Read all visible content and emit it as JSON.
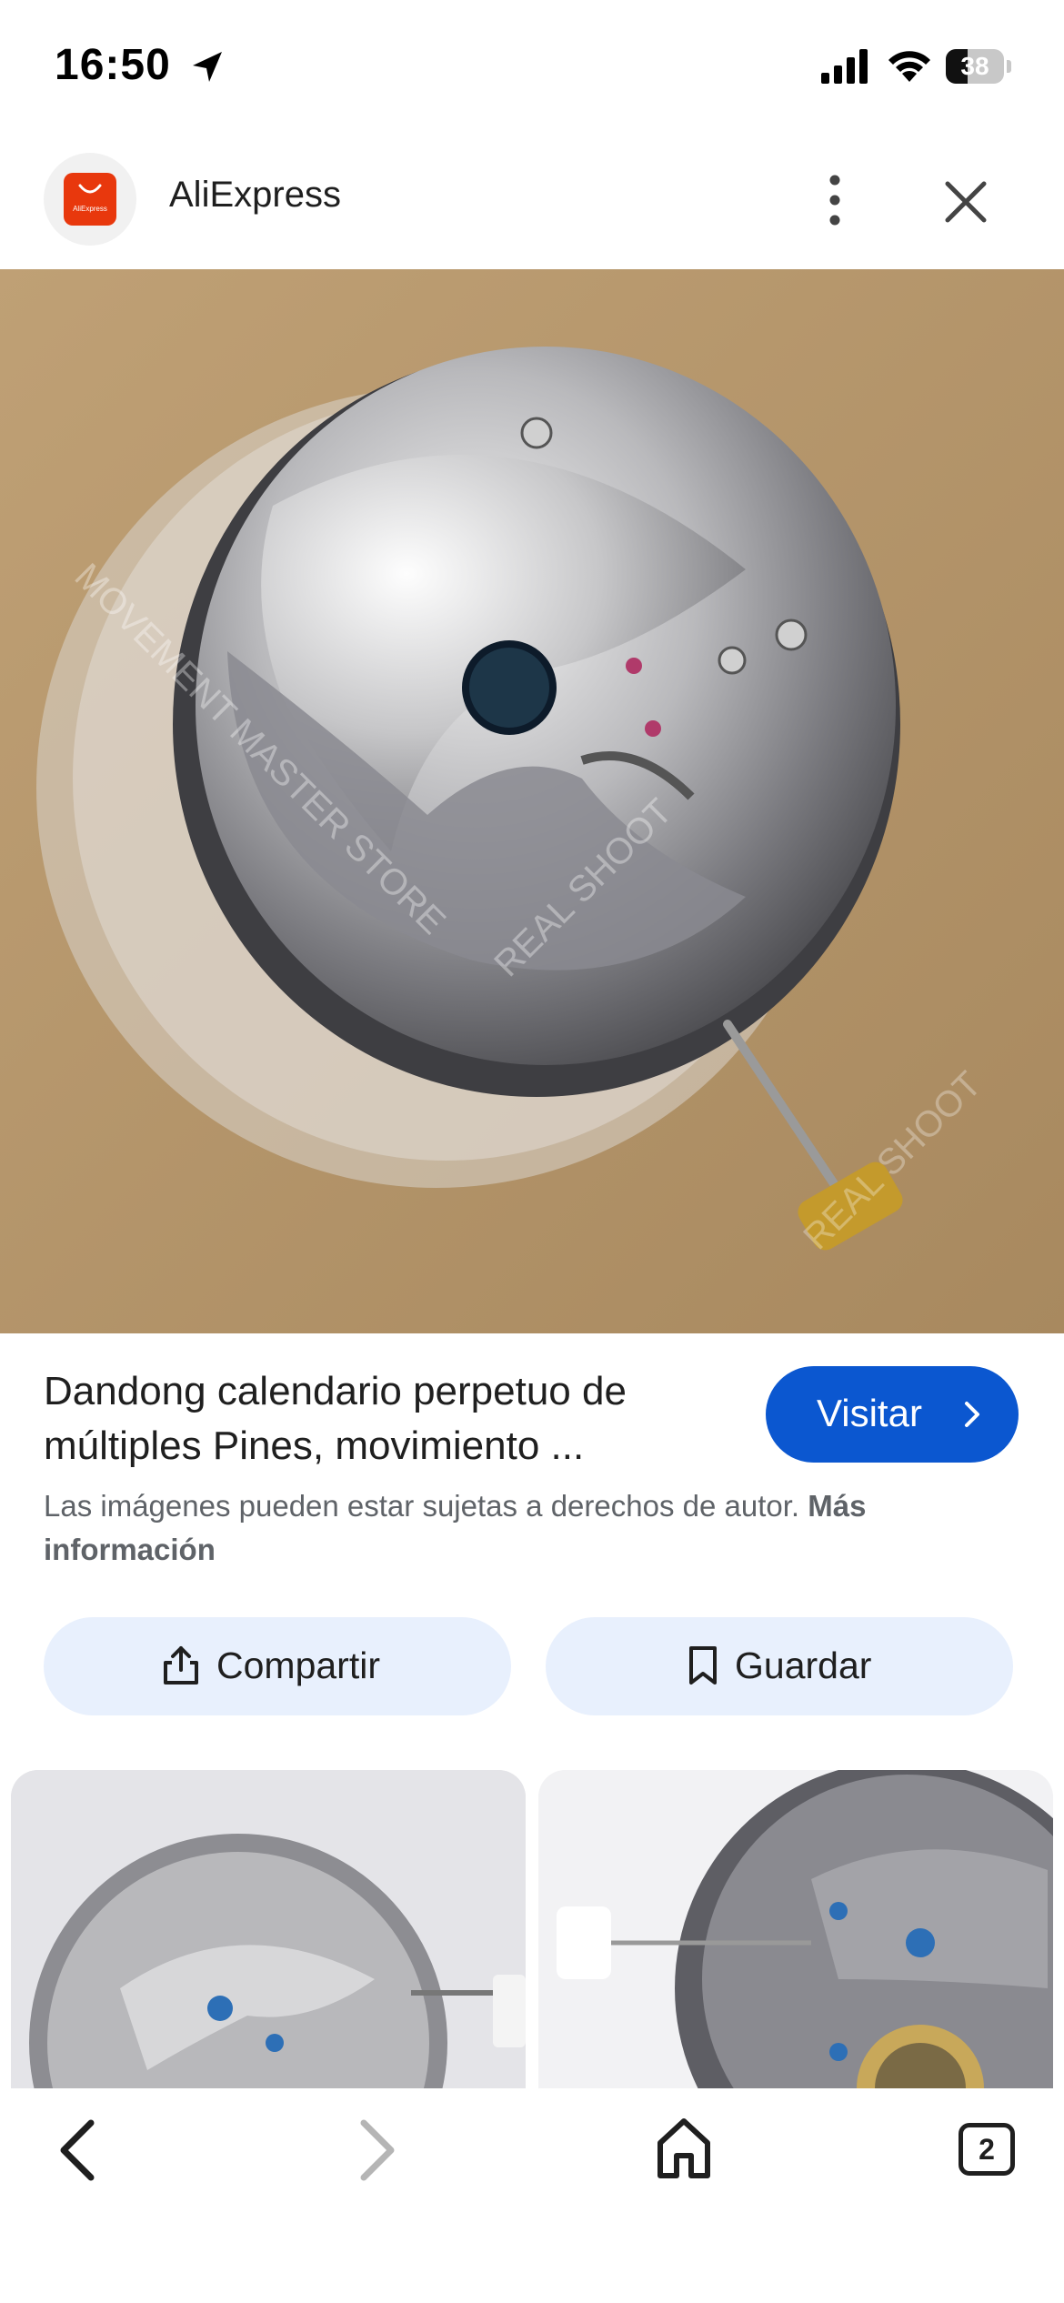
{
  "status_bar": {
    "time": "16:50",
    "battery_percent": "38",
    "battery_level": 0.38,
    "icons": [
      "location-arrow-icon",
      "signal-icon",
      "wifi-icon",
      "battery-icon"
    ]
  },
  "header": {
    "app_name": "AliExpress",
    "logo_text": "AliExpress",
    "logo_color": "#e8380d",
    "more_icon": "more-vertical-icon",
    "close_icon": "close-icon"
  },
  "product": {
    "title": "Dandong calendario perpetuo de múltiples Pines, movimiento ...",
    "visit_label": "Visitar",
    "copyright_text": "Las imágenes pueden estar sujetas a derechos de autor.",
    "more_info_label": "Más información",
    "accent_color": "#0b57d0"
  },
  "actions": {
    "share_label": "Compartir",
    "save_label": "Guardar"
  },
  "bottom_nav": {
    "tab_count": "2",
    "icons": [
      "back-arrow-icon",
      "forward-arrow-icon",
      "home-icon",
      "tabs-icon"
    ]
  }
}
